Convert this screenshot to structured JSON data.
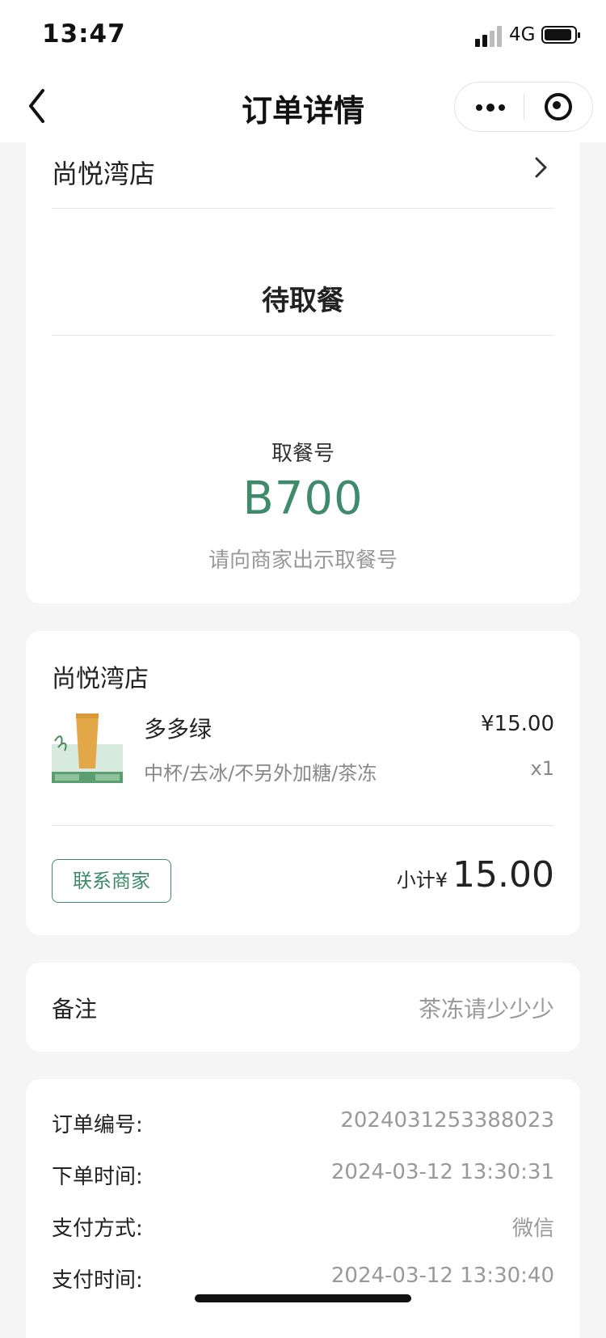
{
  "status_bar": {
    "time": "13:47",
    "network": "4G"
  },
  "nav": {
    "title": "订单详情"
  },
  "order_status": {
    "store_name": "尚悦湾店",
    "status": "待取餐",
    "pickup_label": "取餐号",
    "pickup_number": "B700",
    "pickup_hint": "请向商家出示取餐号"
  },
  "items_card": {
    "store_name": "尚悦湾店",
    "items": [
      {
        "name": "多多绿",
        "price": "¥15.00",
        "spec": "中杯/去冰/不另外加糖/茶冻",
        "qty": "x1"
      }
    ],
    "contact_label": "联系商家",
    "subtotal_label": "小计¥",
    "subtotal_value": "15.00"
  },
  "remark": {
    "label": "备注",
    "value": "茶冻请少少少"
  },
  "order_info": [
    {
      "label": "订单编号:",
      "value": "2024031253388023"
    },
    {
      "label": "下单时间:",
      "value": "2024-03-12 13:30:31"
    },
    {
      "label": "支付方式:",
      "value": "微信"
    },
    {
      "label": "支付时间:",
      "value": "2024-03-12 13:30:40"
    }
  ],
  "colors": {
    "accent": "#3e8a6b",
    "background": "#f5f5f5"
  },
  "icons": [
    "back-icon",
    "more-icon",
    "close-miniprogram-icon",
    "chevron-right-icon",
    "signal-icon",
    "battery-icon"
  ]
}
